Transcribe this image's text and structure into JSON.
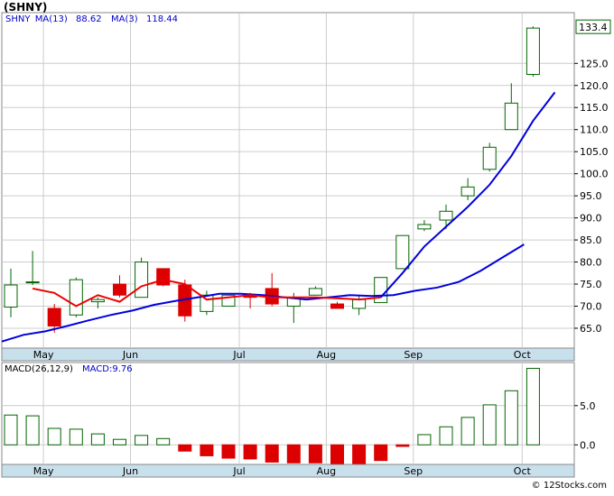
{
  "title": "(SHNY)",
  "credit": "© 12Stocks.com",
  "colors": {
    "up": "#006400",
    "down": "#dd0000",
    "ma_short": "#ee0000",
    "ma_long": "#0000dd",
    "axis_bg": "#c8e0ec",
    "grid": "#cccccc",
    "legend_text": "#0000cc"
  },
  "chart_data": [
    {
      "type": "candlestick",
      "legend": [
        {
          "text": "SHNY",
          "color": "#0000cc"
        },
        {
          "text": "MA(13)",
          "color": "#0000cc"
        },
        {
          "text": "88.62",
          "color": "#0000cc"
        },
        {
          "text": "MA(3)",
          "color": "#0000cc"
        },
        {
          "text": "118.44",
          "color": "#0000cc"
        }
      ],
      "x_labels": [
        "May",
        "Jun",
        "Jul",
        "Aug",
        "Sep",
        "Oct"
      ],
      "x_label_index": [
        1,
        5,
        10,
        14,
        18,
        23
      ],
      "y_ticks": [
        65,
        70,
        75,
        80,
        85,
        90,
        95,
        100,
        105,
        110,
        115,
        120,
        125
      ],
      "ylim": [
        60.5,
        136.5
      ],
      "last_price": "133.4",
      "candles": [
        {
          "o": 69.8,
          "h": 78.5,
          "l": 67.5,
          "c": 74.8
        },
        {
          "o": 75.5,
          "h": 82.5,
          "l": 74.8,
          "c": 75.5
        },
        {
          "o": 69.5,
          "h": 70.5,
          "l": 64.0,
          "c": 65.5
        },
        {
          "o": 68.0,
          "h": 76.5,
          "l": 67.5,
          "c": 76.0
        },
        {
          "o": 71.0,
          "h": 72.0,
          "l": 69.5,
          "c": 71.5
        },
        {
          "o": 75.0,
          "h": 77.0,
          "l": 72.0,
          "c": 72.5
        },
        {
          "o": 72.0,
          "h": 81.0,
          "l": 72.0,
          "c": 80.0
        },
        {
          "o": 78.5,
          "h": 78.5,
          "l": 74.5,
          "c": 74.8
        },
        {
          "o": 74.8,
          "h": 76.0,
          "l": 66.5,
          "c": 67.8
        },
        {
          "o": 68.8,
          "h": 73.5,
          "l": 68.0,
          "c": 72.5
        },
        {
          "o": 70.0,
          "h": 72.5,
          "l": 70.0,
          "c": 72.5
        },
        {
          "o": 72.5,
          "h": 73.0,
          "l": 69.5,
          "c": 72.0
        },
        {
          "o": 74.0,
          "h": 77.5,
          "l": 70.0,
          "c": 70.5
        },
        {
          "o": 70.0,
          "h": 73.0,
          "l": 66.2,
          "c": 72.0
        },
        {
          "o": 72.5,
          "h": 74.5,
          "l": 72.5,
          "c": 74.0
        },
        {
          "o": 70.5,
          "h": 71.0,
          "l": 69.5,
          "c": 69.5
        },
        {
          "o": 69.5,
          "h": 72.5,
          "l": 68.0,
          "c": 71.5
        },
        {
          "o": 70.8,
          "h": 76.5,
          "l": 70.8,
          "c": 76.5
        },
        {
          "o": 78.5,
          "h": 86.0,
          "l": 78.5,
          "c": 86.0
        },
        {
          "o": 87.5,
          "h": 89.5,
          "l": 87.0,
          "c": 88.5
        },
        {
          "o": 89.5,
          "h": 93.0,
          "l": 87.5,
          "c": 91.5
        },
        {
          "o": 95.0,
          "h": 99.0,
          "l": 94.0,
          "c": 97.0
        },
        {
          "o": 101.0,
          "h": 107.0,
          "l": 100.5,
          "c": 106.0
        },
        {
          "o": 110.0,
          "h": 120.5,
          "l": 110.0,
          "c": 116.0
        },
        {
          "o": 122.5,
          "h": 133.4,
          "l": 122.0,
          "c": 133.0
        }
      ],
      "ma13": [
        62.0,
        63.5,
        64.3,
        65.5,
        66.8,
        68.0,
        69.0,
        70.3,
        71.2,
        72.0,
        72.8,
        72.8,
        72.5,
        72.0,
        71.5,
        72.0,
        72.5,
        72.3,
        72.5,
        73.5,
        74.2,
        75.5,
        78.0,
        81.0,
        84.0,
        88.62
      ],
      "ma3": [
        null,
        74.0,
        73.0,
        70.0,
        72.5,
        71.0,
        74.5,
        76.0,
        75.0,
        71.5,
        72.0,
        72.5,
        72.0,
        72.0,
        72.0,
        71.8,
        71.5,
        72.0,
        null,
        null,
        null,
        null,
        null,
        null,
        null,
        null
      ],
      "ma3_up": [
        null,
        null,
        null,
        null,
        null,
        null,
        null,
        null,
        null,
        null,
        null,
        null,
        null,
        null,
        null,
        null,
        null,
        72.0,
        77.5,
        83.5,
        88.0,
        92.5,
        97.5,
        104.0,
        112.0,
        118.44
      ]
    },
    {
      "type": "bar",
      "legend": [
        {
          "text": "MACD(26,12,9)",
          "color": "#000000"
        },
        {
          "text": "MACD:9.76",
          "color": "#0000cc"
        }
      ],
      "y_ticks": [
        0.0,
        5.0
      ],
      "y_tick_labels": [
        "0.0",
        "5.0"
      ],
      "ylim": [
        -2.5,
        10.5
      ],
      "values": [
        3.8,
        3.7,
        2.1,
        2.0,
        1.4,
        0.7,
        1.2,
        0.8,
        -0.8,
        -1.4,
        -1.7,
        -1.8,
        -2.2,
        -2.3,
        -2.3,
        -2.4,
        -2.4,
        -2.0,
        -0.2,
        1.3,
        2.3,
        3.5,
        5.1,
        6.9,
        9.76
      ]
    }
  ]
}
